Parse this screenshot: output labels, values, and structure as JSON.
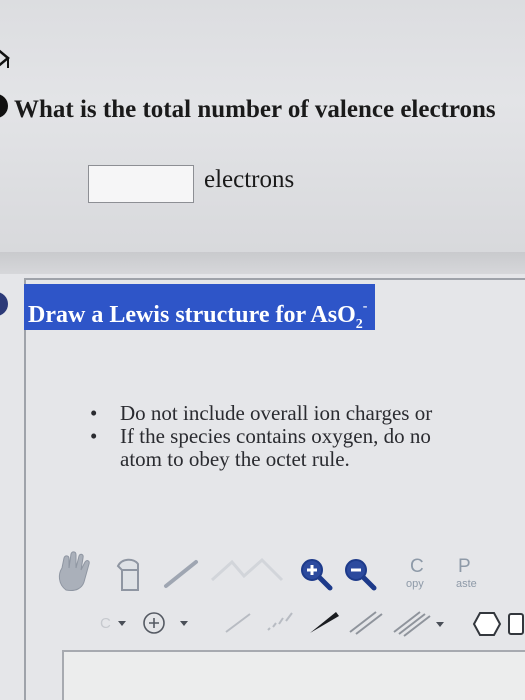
{
  "question": {
    "text": "What is the total number of valence electrons",
    "unit_label": "electrons",
    "answer_value": ""
  },
  "panel": {
    "title_prefix": "Draw a Lewis structure for AsO",
    "title_subscript": "2",
    "title_superscript": "-",
    "instructions": [
      "Do not include overall ion charges or",
      "If the species contains oxygen, do no",
      "atom to obey the octet rule."
    ]
  },
  "toolbar": {
    "copy_letter": "C",
    "copy_rest": "opy",
    "paste_letter": "P",
    "paste_rest": "aste"
  },
  "colors": {
    "title_bar": "#2e55c8",
    "zoom_icon": "#1d3a8a"
  }
}
